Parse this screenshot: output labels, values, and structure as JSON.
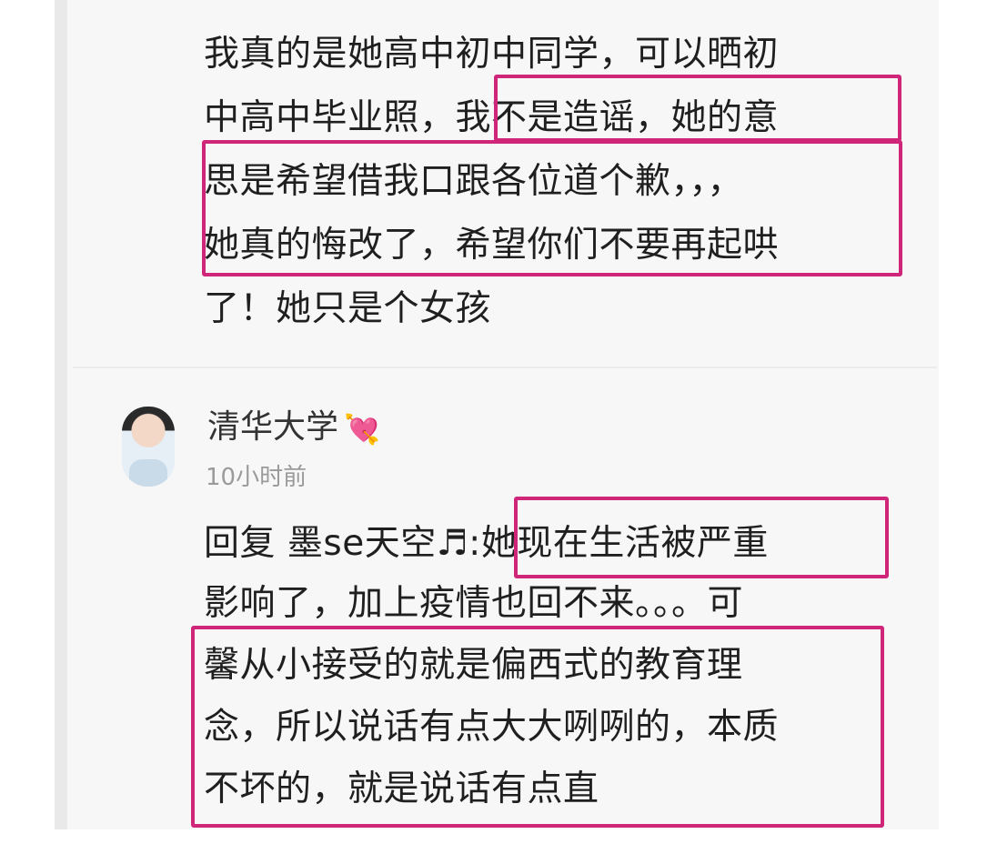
{
  "post": {
    "lines": [
      "我真的是她高中初中同学，可以晒初",
      "中高中毕业照，我不是造谣，她的意",
      "思是希望借我口跟各位道个歉，，，",
      "她真的悔改了，希望你们不要再起哄",
      "了！她只是个女孩"
    ]
  },
  "comment": {
    "username": "清华大学",
    "badge_icon": "heart-arrow-icon",
    "time": "10小时前",
    "lines": [
      "回复 墨se天空♬:她现在生活被严重",
      "影响了，加上疫情也回不来。。。可",
      "馨从小接受的就是偏西式的教育理",
      "念，所以说话有点大大咧咧的，本质",
      "不坏的，就是说话有点直"
    ]
  },
  "colors": {
    "highlight": "#d0267a",
    "text": "#1f1f1f",
    "meta": "#9a9a9a"
  }
}
